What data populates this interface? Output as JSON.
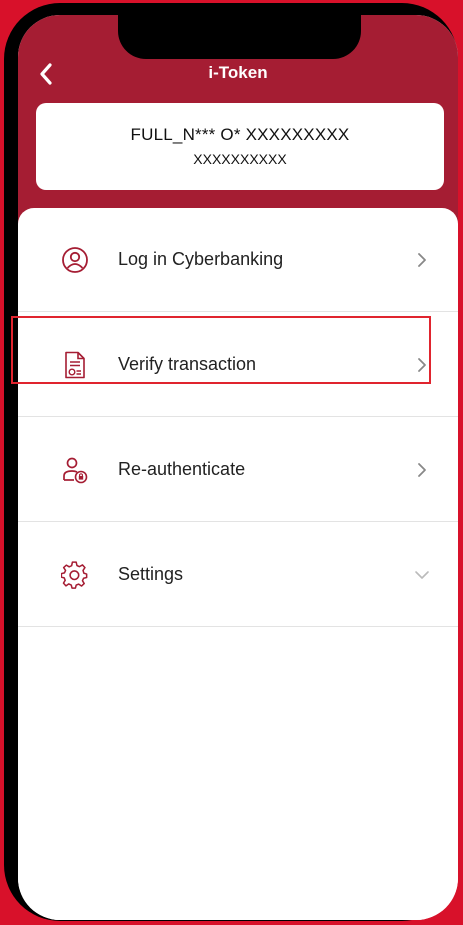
{
  "header": {
    "title": "i-Token"
  },
  "account": {
    "line1": "FULL_N*** O*  XXXXXXXXX",
    "line2": "XXXXXXXXXX"
  },
  "menu": {
    "items": [
      {
        "label": "Log in Cyberbanking",
        "icon": "user-circle-icon",
        "chevron": "chevron-right-icon"
      },
      {
        "label": "Verify transaction",
        "icon": "document-check-icon",
        "chevron": "chevron-right-icon"
      },
      {
        "label": "Re-authenticate",
        "icon": "user-lock-icon",
        "chevron": "chevron-right-icon"
      },
      {
        "label": "Settings",
        "icon": "gear-icon",
        "chevron": "chevron-down-icon"
      }
    ]
  },
  "colors": {
    "brand": "#a51d33",
    "background": "#d8112a",
    "highlight": "#e0242e",
    "icon": "#a51d33"
  }
}
